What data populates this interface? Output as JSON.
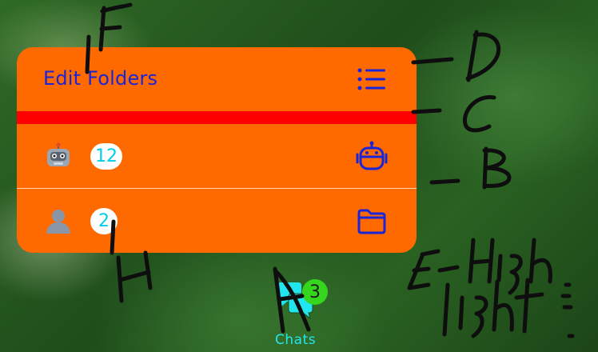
{
  "menu": {
    "title": "Edit Folders",
    "title_icon": "list-icon",
    "rows": [
      {
        "emoji": "🤖",
        "count": "12",
        "icon": "robot-icon"
      },
      {
        "emoji": "👤",
        "count": "2",
        "icon": "folder-icon"
      }
    ]
  },
  "tabbar": {
    "chats": {
      "label": "Chats",
      "badge": "3",
      "icon": "chat-bubbles-icon"
    }
  },
  "colors": {
    "menu_background": "#ff6a00",
    "accent_blue": "#1a24d8",
    "highlight_separator": "#ff0000",
    "badge_text": "#00cfe6",
    "tab_label": "#22e5ee",
    "tab_badge": "#37d61e"
  },
  "annotation_labels": [
    "F",
    "D",
    "C",
    "B",
    "E - High light",
    "A",
    "H"
  ]
}
